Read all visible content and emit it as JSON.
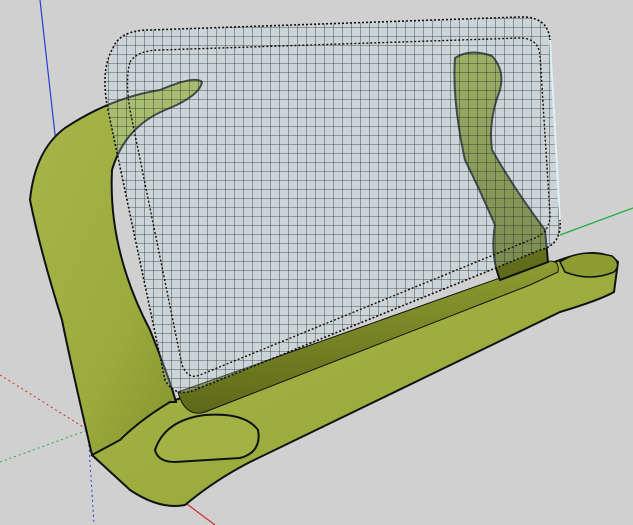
{
  "app": {
    "view": "3d-modeling-viewport",
    "background_color": "#d0d0d0"
  },
  "axes": {
    "blue_axis_color": "#2a3dd6",
    "red_axis_color": "#d42a2a",
    "green_axis_color": "#1fae3a"
  },
  "model": {
    "body_color": "#9bab3c",
    "body_shadow_color": "#6f7b22",
    "edge_color": "#111111",
    "mesh_line_color": "#1a1a1a",
    "mesh_highlight_color": "#9fd3df"
  }
}
